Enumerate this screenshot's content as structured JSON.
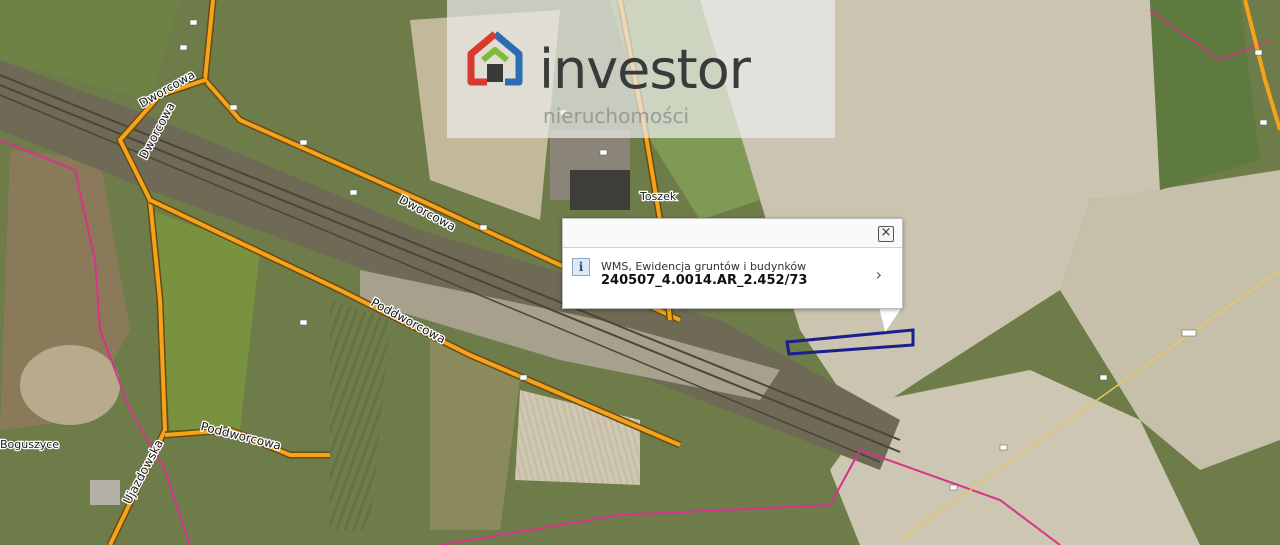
{
  "map": {
    "road_labels": {
      "dworcowa_north": "Dworcowa",
      "dworcowa_vertical": "Dworcowa",
      "dworcowa_middle": "Dworcowa",
      "poddworcowa_main": "Poddworcowa",
      "poddworcowa_south": "Poddworcowa",
      "ujazdowska": "Ujazdowska",
      "toszek_label": "Toszek"
    },
    "place_labels": {
      "boguszyce": "Boguszyce"
    },
    "colors": {
      "road_casing": "#f5a31a",
      "road_core": "#6b4a12",
      "boundary": "#d6338a",
      "parcel_outline": "#1a1f8c",
      "grid_line": "#e8c766"
    }
  },
  "watermark": {
    "brand_name": "investor",
    "brand_sub": "nieruchomości",
    "logo_colors": {
      "red": "#d93a30",
      "green": "#7dbb3a",
      "blue": "#2a6db5",
      "gray": "#3a3a3a"
    }
  },
  "popup": {
    "close_symbol": "×",
    "info_icon": "i",
    "layer_name": "WMS, Ewidencja gruntów i budynków",
    "parcel_id": "240507_4.0014.AR_2.452/73",
    "next_symbol": "›"
  }
}
